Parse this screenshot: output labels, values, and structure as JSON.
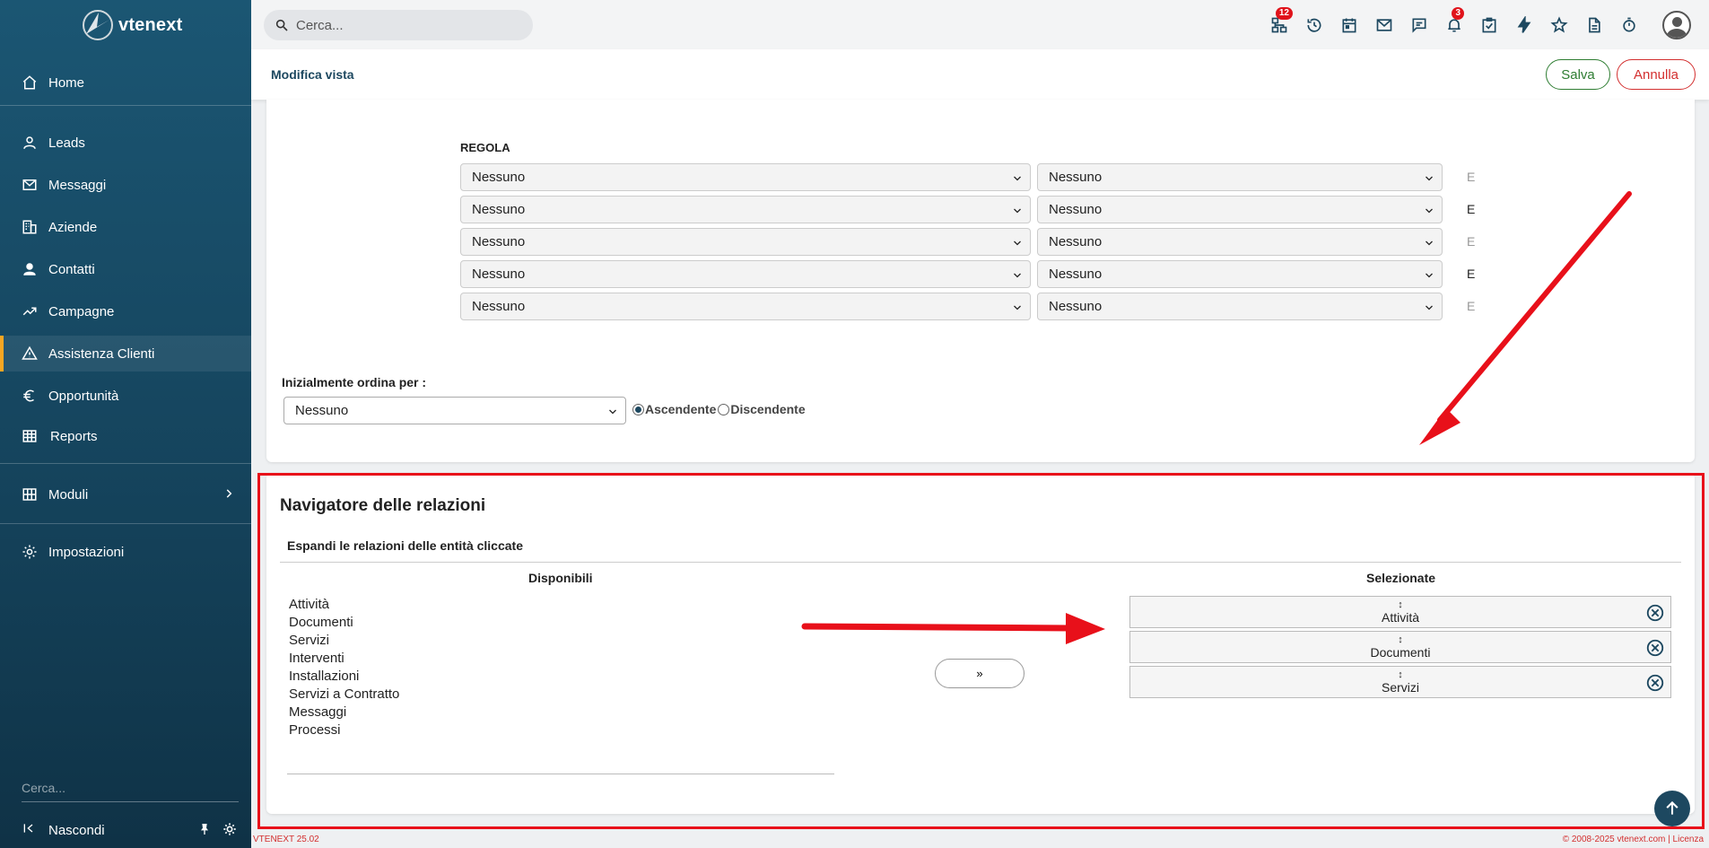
{
  "app": {
    "logo_text": "vtenext",
    "version": "VTENEXT 25.02",
    "copyright": "© 2008-2025 vtenext.com | Licenza"
  },
  "sidebar": {
    "items": [
      {
        "label": "Home",
        "icon": "home-icon"
      },
      {
        "label": "Leads",
        "icon": "person-icon"
      },
      {
        "label": "Messaggi",
        "icon": "mail-icon"
      },
      {
        "label": "Aziende",
        "icon": "building-icon"
      },
      {
        "label": "Contatti",
        "icon": "contact-icon"
      },
      {
        "label": "Campagne",
        "icon": "trend-icon"
      },
      {
        "label": "Assistenza Clienti",
        "icon": "warning-icon"
      },
      {
        "label": "Opportunità",
        "icon": "euro-icon"
      },
      {
        "label": "Reports",
        "icon": "table-icon"
      },
      {
        "label": "Moduli",
        "icon": "grid-icon"
      },
      {
        "label": "Impostazioni",
        "icon": "gear-icon"
      }
    ],
    "search_placeholder": "Cerca...",
    "hide_label": "Nascondi"
  },
  "topbar": {
    "search_placeholder": "Cerca...",
    "badges": {
      "processes": "12",
      "notifications": "3"
    }
  },
  "subheader": {
    "title": "Modifica vista",
    "save_label": "Salva",
    "cancel_label": "Annulla"
  },
  "rules": {
    "heading": "REGOLA",
    "rows": [
      {
        "left": "Nessuno",
        "right": "Nessuno",
        "conj": "E"
      },
      {
        "left": "Nessuno",
        "right": "Nessuno",
        "conj": "E"
      },
      {
        "left": "Nessuno",
        "right": "Nessuno",
        "conj": "E"
      },
      {
        "left": "Nessuno",
        "right": "Nessuno",
        "conj": "E"
      },
      {
        "left": "Nessuno",
        "right": "Nessuno",
        "conj": "E"
      }
    ]
  },
  "sort": {
    "label": "Inizialmente ordina per :",
    "value": "Nessuno",
    "asc_label": "Ascendente",
    "desc_label": "Discendente",
    "selected": "asc"
  },
  "navigator": {
    "title": "Navigatore delle relazioni",
    "subtitle": "Espandi le relazioni delle entità cliccate",
    "available_header": "Disponibili",
    "selected_header": "Selezionate",
    "available": [
      "Attività",
      "Documenti",
      "Servizi",
      "Interventi",
      "Installazioni",
      "Servizi a Contratto",
      "Messaggi",
      "Processi"
    ],
    "selected": [
      "Attività",
      "Documenti",
      "Servizi"
    ],
    "move_label": "»",
    "grip_symbol": "↕"
  }
}
